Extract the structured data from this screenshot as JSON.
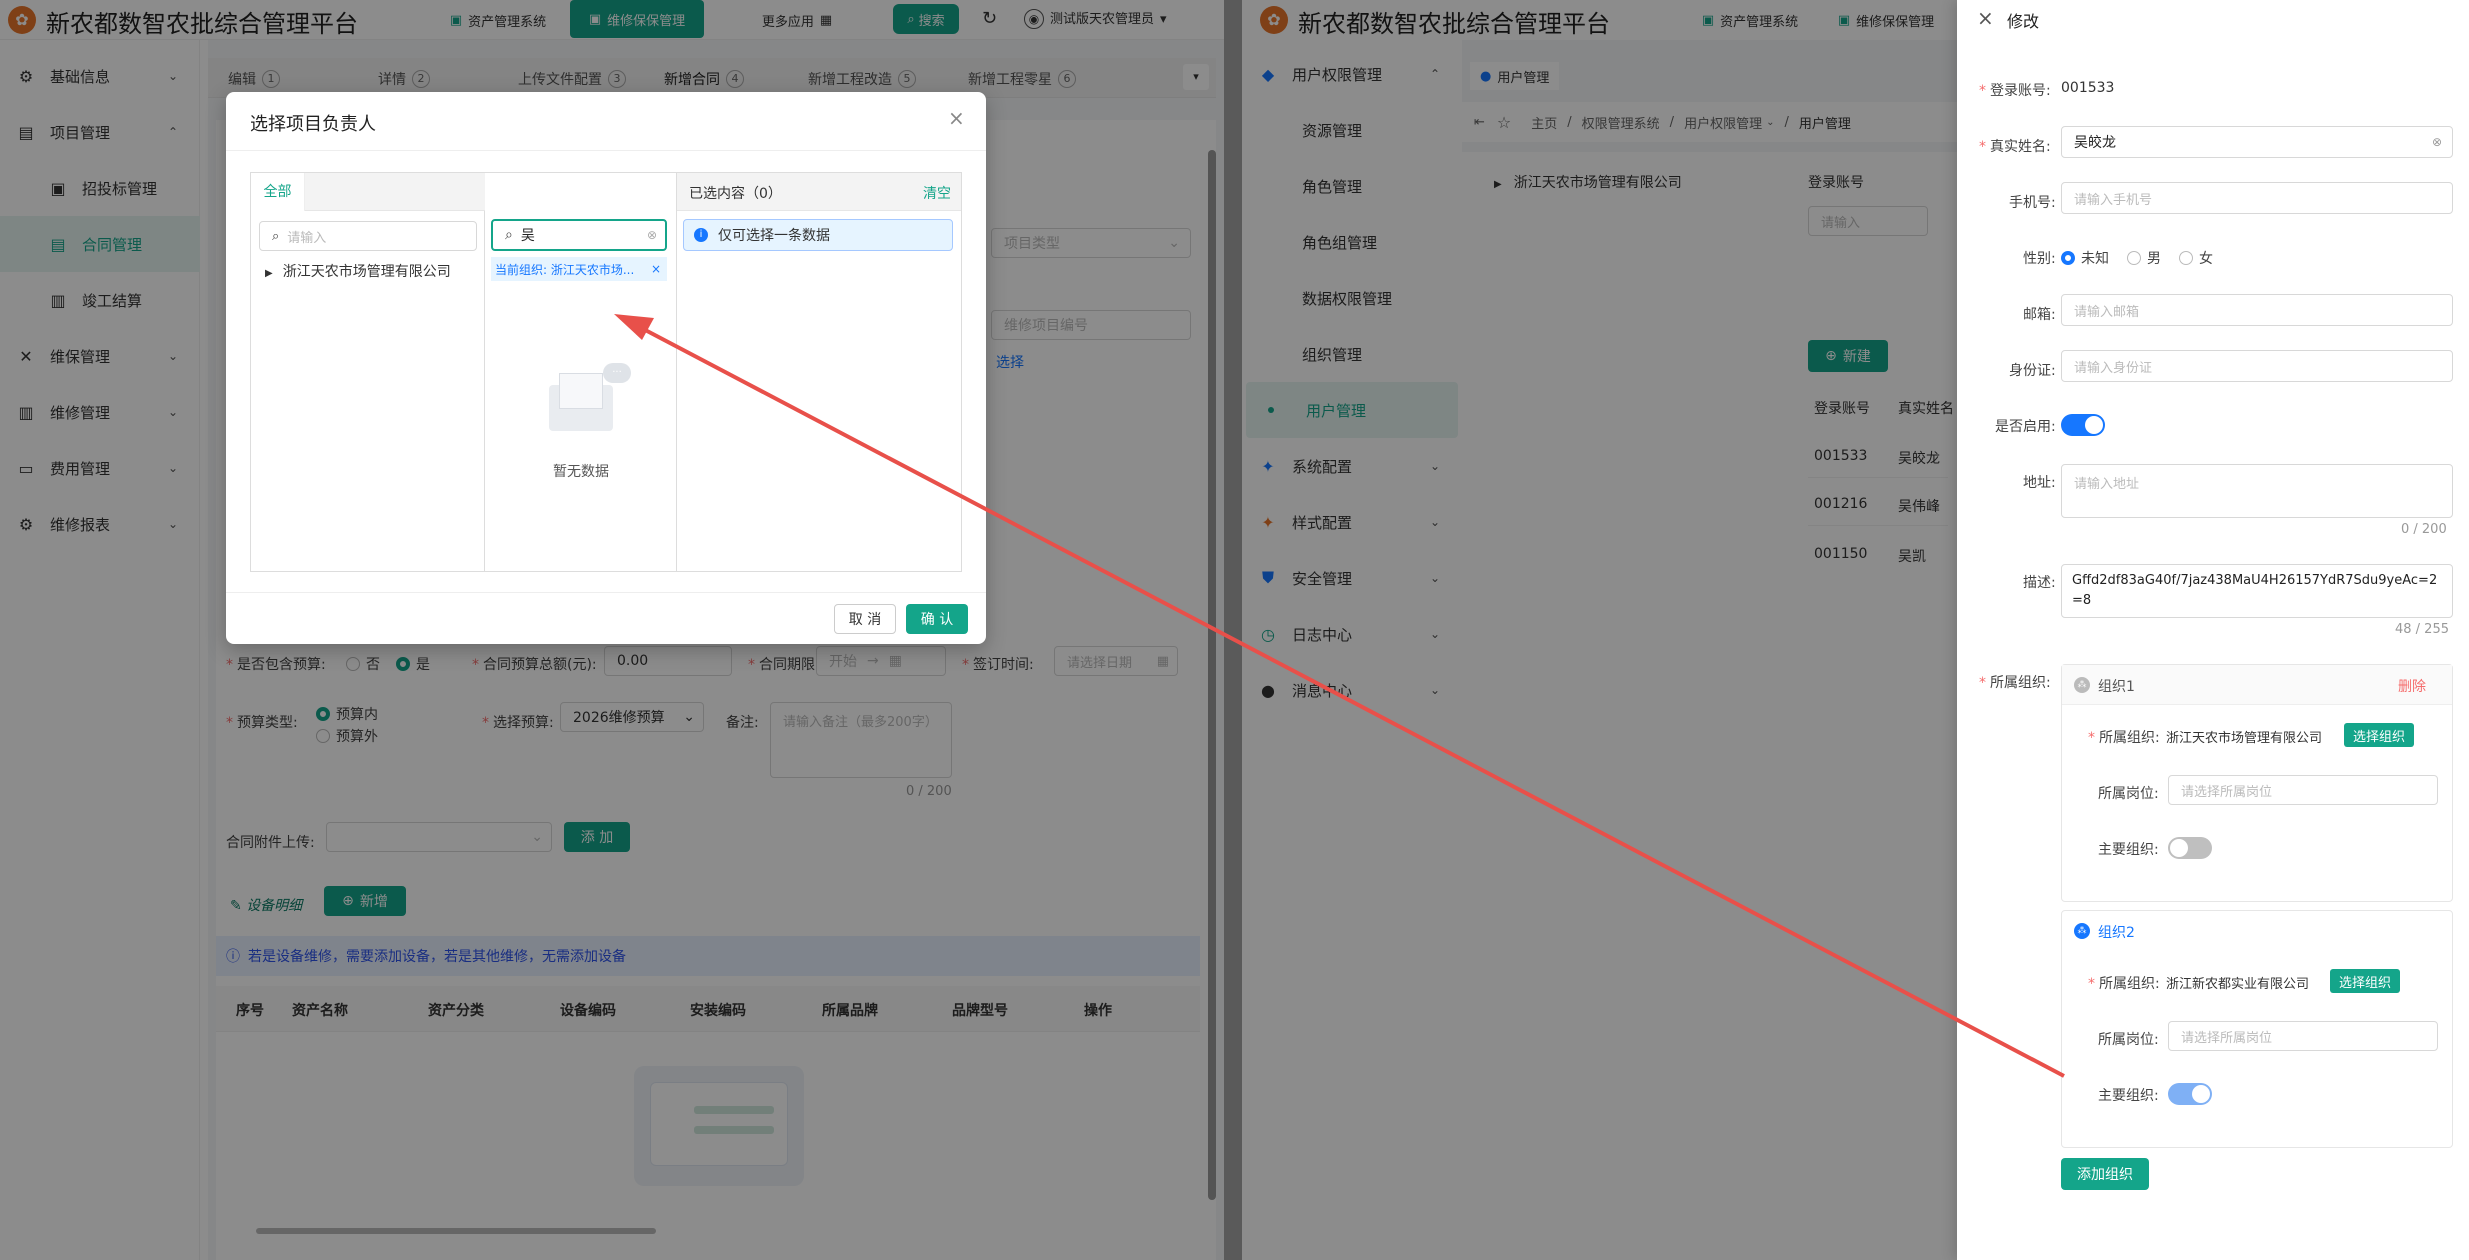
{
  "left": {
    "app_title": "新农都数智农批综合管理平台",
    "header_btns": [
      "资产管理系统",
      "维修保保管理"
    ],
    "more_apps": "更多应用",
    "search_btn": "搜索",
    "user": "测试版天农管理员",
    "sidebar": [
      {
        "label": "基础信息",
        "icon": "gear-icon"
      },
      {
        "label": "项目管理",
        "icon": "project-icon"
      },
      {
        "label": "招投标管理",
        "icon": "bid-icon"
      },
      {
        "label": "合同管理",
        "icon": "contract-icon"
      },
      {
        "label": "竣工结算",
        "icon": "settle-icon"
      },
      {
        "label": "维保管理",
        "icon": "tools-icon"
      },
      {
        "label": "维修管理",
        "icon": "building-icon"
      },
      {
        "label": "费用管理",
        "icon": "cost-icon"
      },
      {
        "label": "维修报表",
        "icon": "gear-icon"
      }
    ],
    "tabs": [
      {
        "label": "编辑",
        "num": "1"
      },
      {
        "label": "详情",
        "num": "2"
      },
      {
        "label": "上传文件配置",
        "num": "3"
      },
      {
        "label": "新增合同",
        "num": "4"
      },
      {
        "label": "新增工程改造",
        "num": "5"
      },
      {
        "label": "新增工程零星",
        "num": "6"
      }
    ],
    "project_type_placeholder": "项目类型",
    "project_no_placeholder": "维修项目编号",
    "select_link": "选择",
    "form": {
      "include_budget_label": "是否包含预算:",
      "no": "否",
      "yes": "是",
      "budget_total_label": "合同预算总额(元):",
      "budget_total_value": "0.00",
      "contract_period_label": "合同期限:",
      "start": "开始",
      "sign_time_label": "签订时间:",
      "sign_time_placeholder": "请选择日期",
      "budget_type_label": "预算类型:",
      "budget_in": "预算内",
      "budget_out": "预算外",
      "select_budget_label": "选择预算:",
      "select_budget_value": "2026维修预算",
      "remark_label": "备注:",
      "remark_placeholder": "请输入备注（最多200字）",
      "remark_count": "0 / 200",
      "attach_label": "合同附件上传:",
      "add_btn": "添 加"
    },
    "equipment": {
      "title": "设备明细",
      "new_btn": "新增",
      "info": "若是设备维修，需要添加设备，若是其他维修，无需添加设备",
      "columns": [
        "序号",
        "资产名称",
        "资产分类",
        "设备编码",
        "安装编码",
        "所属品牌",
        "品牌型号",
        "操作"
      ]
    }
  },
  "dialog": {
    "title": "选择项目负责人",
    "tab_all": "全部",
    "search_placeholder": "请输入",
    "org_tree_item": "浙江天农市场管理有限公司",
    "search_value": "吴",
    "current_org_tag": "当前组织: 浙江天农市场...",
    "empty_text": "暂无数据",
    "selected_title": "已选内容（0）",
    "clear": "清空",
    "only_one_tip": "仅可选择一条数据",
    "cancel": "取 消",
    "confirm": "确 认"
  },
  "right": {
    "app_title": "新农都数智农批综合管理平台",
    "header_btns": [
      "资产管理系统",
      "维修保保管理"
    ],
    "sidebar": [
      {
        "label": "用户权限管理",
        "icon": "user-perm-icon",
        "expanded": true
      },
      {
        "label": "资源管理"
      },
      {
        "label": "角色管理"
      },
      {
        "label": "角色组管理"
      },
      {
        "label": "数据权限管理"
      },
      {
        "label": "组织管理"
      },
      {
        "label": "用户管理",
        "active": true
      },
      {
        "label": "系统配置",
        "icon": "settings-icon"
      },
      {
        "label": "样式配置",
        "icon": "style-icon"
      },
      {
        "label": "安全管理",
        "icon": "shield-icon"
      },
      {
        "label": "日志中心",
        "icon": "log-icon"
      },
      {
        "label": "消息中心",
        "icon": "message-icon"
      }
    ],
    "tab": "用户管理",
    "breadcrumb": [
      "主页",
      "权限管理系统",
      "用户权限管理",
      "用户管理"
    ],
    "tree_item": "浙江天农市场管理有限公司",
    "login_account_label": "登录账号",
    "login_account_placeholder": "请输入",
    "new_btn": "新建",
    "table_headers": [
      "登录账号",
      "真实姓名"
    ],
    "rows": [
      {
        "account": "001533",
        "name": "吴皎龙"
      },
      {
        "account": "001216",
        "name": "吴伟峰"
      },
      {
        "account": "001150",
        "name": "吴凯"
      }
    ]
  },
  "drawer": {
    "title": "修改",
    "login_account_label": "登录账号:",
    "login_account": "001533",
    "real_name_label": "真实姓名:",
    "real_name": "吴皎龙",
    "phone_label": "手机号:",
    "phone_placeholder": "请输入手机号",
    "gender_label": "性别:",
    "gender_options": [
      "未知",
      "男",
      "女"
    ],
    "email_label": "邮箱:",
    "email_placeholder": "请输入邮箱",
    "id_label": "身份证:",
    "id_placeholder": "请输入身份证",
    "enabled_label": "是否启用:",
    "address_label": "地址:",
    "address_placeholder": "请输入地址",
    "address_count": "0 / 200",
    "desc_label": "描述:",
    "desc_value": "Gffd2df83aG40f/7jaz438MaU4H26157YdR7Sdu9yeAc=2=8",
    "desc_count": "48 / 255",
    "org_label": "所属组织:",
    "org1": {
      "title": "组织1",
      "delete": "删除",
      "org_label": "所属组织:",
      "org_value": "浙江天农市场管理有限公司",
      "select_btn": "选择组织",
      "post_label": "所属岗位:",
      "post_placeholder": "请选择所属岗位",
      "main_label": "主要组织:"
    },
    "org2": {
      "title": "组织2",
      "org_label": "所属组织:",
      "org_value": "浙江新农都实业有限公司",
      "select_btn": "选择组织",
      "post_label": "所属岗位:",
      "post_placeholder": "请选择所属岗位",
      "main_label": "主要组织:"
    },
    "add_org_btn": "添加组织"
  },
  "colors": {
    "accent": "#14a58a",
    "arrow": "#e8504a",
    "toggle_on": "#1677ff",
    "danger": "#f56c6c"
  }
}
